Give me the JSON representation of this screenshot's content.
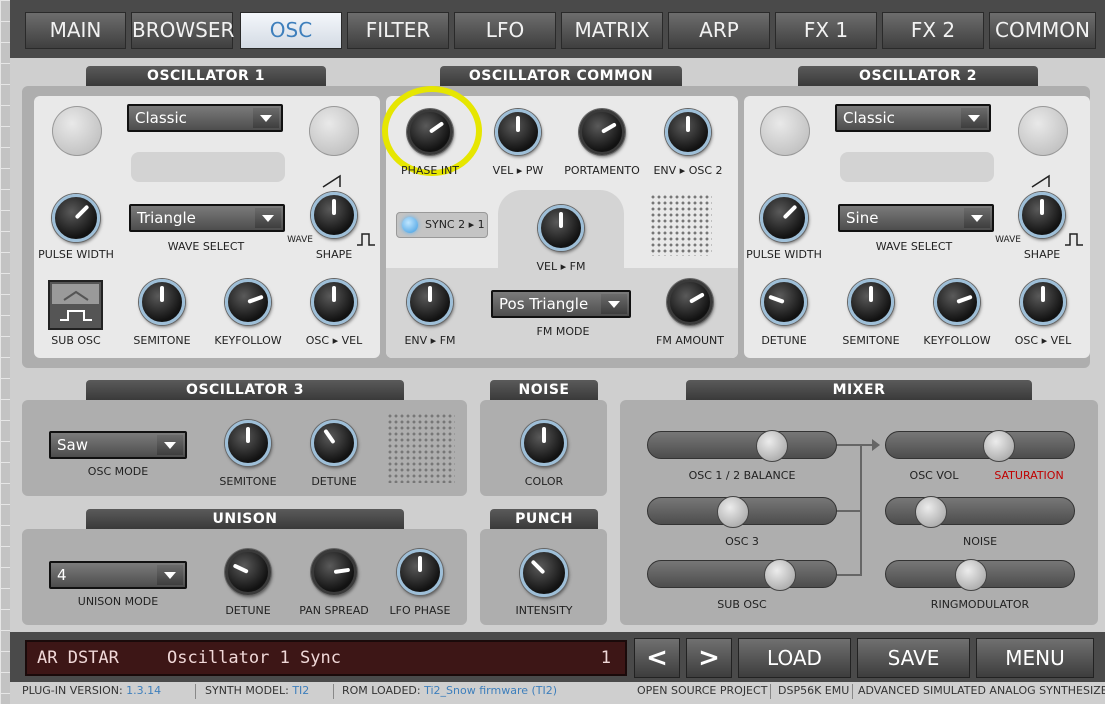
{
  "tabs": [
    {
      "label": "MAIN",
      "active": false
    },
    {
      "label": "BROWSER",
      "active": false
    },
    {
      "label": "OSC",
      "active": true
    },
    {
      "label": "FILTER",
      "active": false
    },
    {
      "label": "LFO",
      "active": false
    },
    {
      "label": "MATRIX",
      "active": false
    },
    {
      "label": "ARP",
      "active": false
    },
    {
      "label": "FX 1",
      "active": false
    },
    {
      "label": "FX 2",
      "active": false
    },
    {
      "label": "COMMON",
      "active": false
    }
  ],
  "osc1": {
    "title": "OSCILLATOR 1",
    "type": "Classic",
    "wave": "Triangle",
    "labels": {
      "pulse_width": "PULSE WIDTH",
      "wave_select": "WAVE SELECT",
      "wave": "WAVE",
      "shape": "SHAPE",
      "sub_osc": "SUB OSC",
      "semitone": "SEMITONE",
      "keyfollow": "KEYFOLLOW",
      "osc_vel": "OSC ▸ VEL"
    }
  },
  "common": {
    "title": "OSCILLATOR COMMON",
    "labels": {
      "phase_int": "PHASE INT",
      "vel_pw": "VEL ▸ PW",
      "portamento": "PORTAMENTO",
      "env_osc2": "ENV ▸ OSC 2",
      "sync": "SYNC 2 ▸ 1",
      "vel_fm": "VEL ▸ FM",
      "env_fm": "ENV ▸ FM",
      "fm_mode": "FM MODE",
      "fm_amount": "FM AMOUNT"
    },
    "fm_mode": "Pos Triangle"
  },
  "osc2": {
    "title": "OSCILLATOR 2",
    "type": "Classic",
    "wave": "Sine",
    "labels": {
      "pulse_width": "PULSE WIDTH",
      "wave_select": "WAVE SELECT",
      "wave": "WAVE",
      "shape": "SHAPE",
      "detune": "DETUNE",
      "semitone": "SEMITONE",
      "keyfollow": "KEYFOLLOW",
      "osc_vel": "OSC ▸ VEL"
    }
  },
  "osc3": {
    "title": "OSCILLATOR 3",
    "mode": "Saw",
    "labels": {
      "osc_mode": "OSC MODE",
      "semitone": "SEMITONE",
      "detune": "DETUNE"
    }
  },
  "noise": {
    "title": "NOISE",
    "labels": {
      "color": "COLOR"
    }
  },
  "mixer": {
    "title": "MIXER",
    "labels": {
      "balance": "OSC 1 / 2 BALANCE",
      "osc3": "OSC 3",
      "sub_osc": "SUB OSC",
      "osc_vol": "OSC VOL",
      "saturation": "SATURATION",
      "noise": "NOISE",
      "ringmod": "RINGMODULATOR"
    },
    "saturation_color": "#c00000"
  },
  "unison": {
    "title": "UNISON",
    "mode": "4",
    "labels": {
      "unison_mode": "UNISON MODE",
      "detune": "DETUNE",
      "pan_spread": "PAN SPREAD",
      "lfo_phase": "LFO PHASE"
    }
  },
  "punch": {
    "title": "PUNCH",
    "labels": {
      "intensity": "INTENSITY"
    }
  },
  "display": {
    "bank": "AR DSTAR",
    "patch": "Oscillator 1 Sync",
    "number": "1"
  },
  "buttons": {
    "prev": "<",
    "next": ">",
    "load": "LOAD",
    "save": "SAVE",
    "menu": "MENU"
  },
  "footer": {
    "plugin_version_label": "PLUG-IN VERSION:",
    "plugin_version": "1.3.14",
    "synth_model_label": "SYNTH MODEL:",
    "synth_model": "TI2",
    "rom_label": "ROM LOADED:",
    "rom": "Ti2_Snow firmware (TI2)",
    "open_source": "OPEN SOURCE PROJECT",
    "dsp": "DSP56K EMU",
    "asas": "ADVANCED SIMULATED ANALOG SYNTHESIZER"
  },
  "colors": {
    "accent": "#3e7fbc",
    "knob_ring": "#9ebfd8",
    "highlight": "#e6e600",
    "lcd_bg": "#3d1616"
  }
}
